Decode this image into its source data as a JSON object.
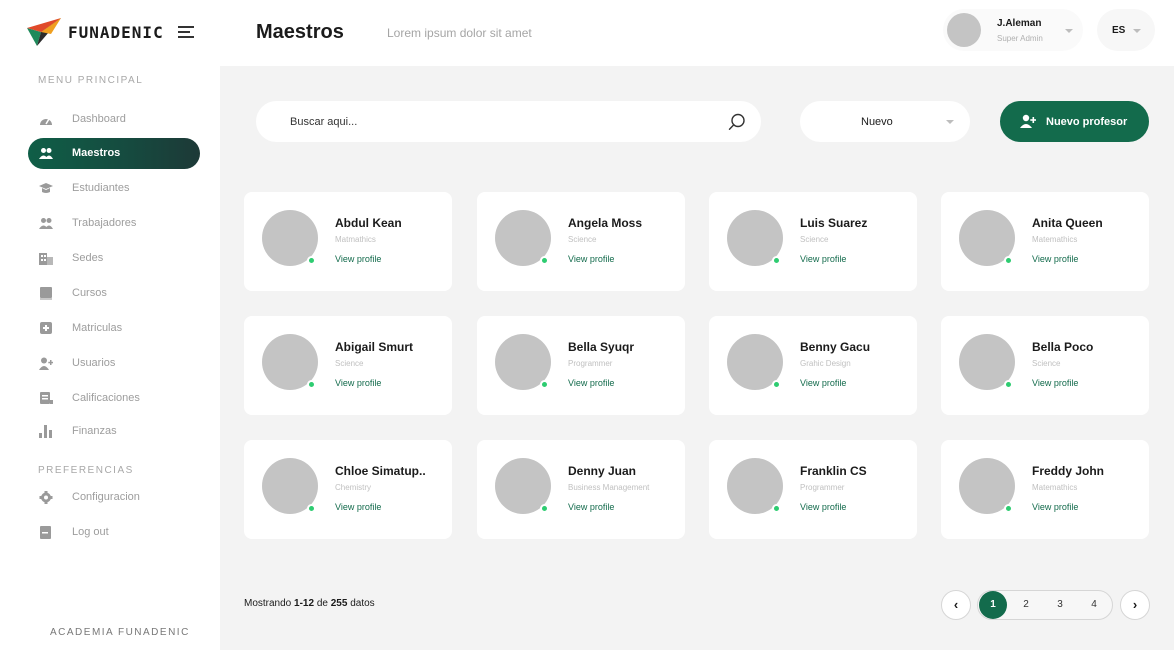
{
  "header": {
    "brand": "FUNADENIC",
    "title": "Maestros",
    "subtitle": "Lorem ipsum  dolor sit amet",
    "user": {
      "name": "J.Aleman",
      "role": "Super Admin"
    },
    "language": "ES"
  },
  "sidebar": {
    "main_section": "MENU PRINCIPAL",
    "items": [
      {
        "label": "Dashboard",
        "icon": "dashboard-icon"
      },
      {
        "label": "Maestros",
        "icon": "teachers-icon",
        "active": true
      },
      {
        "label": "Estudiantes",
        "icon": "graduation-cap-icon"
      },
      {
        "label": "Trabajadores",
        "icon": "workers-icon"
      },
      {
        "label": "Sedes",
        "icon": "building-icon"
      },
      {
        "label": "Cursos",
        "icon": "book-icon"
      },
      {
        "label": "Matriculas",
        "icon": "plus-square-icon"
      },
      {
        "label": "Usuarios",
        "icon": "add-user-icon"
      },
      {
        "label": "Calificaciones",
        "icon": "grades-icon"
      },
      {
        "label": "Finanzas",
        "icon": "bar-chart-icon"
      }
    ],
    "pref_section": "PREFERENCIAS",
    "pref_items": [
      {
        "label": "Configuracion",
        "icon": "gear-icon"
      },
      {
        "label": "Log out",
        "icon": "logout-icon"
      }
    ],
    "footer": "ACADEMIA FUNADENIC"
  },
  "toolbar": {
    "search_placeholder": "Buscar aqui...",
    "filter_value": "Nuevo",
    "new_button": "Nuevo profesor"
  },
  "teachers": [
    {
      "name": "Abdul Kean",
      "subject": "Matmathics",
      "link": "View profile"
    },
    {
      "name": "Angela Moss",
      "subject": "Science",
      "link": "View profile"
    },
    {
      "name": "Luis Suarez",
      "subject": "Science",
      "link": "View profile"
    },
    {
      "name": "Anita Queen",
      "subject": "Matemathics",
      "link": "View profile"
    },
    {
      "name": "Abigail Smurt",
      "subject": "Science",
      "link": "View profile"
    },
    {
      "name": "Bella Syuqr",
      "subject": "Programmer",
      "link": "View profile"
    },
    {
      "name": "Benny Gacu",
      "subject": "Grahic Design",
      "link": "View profile"
    },
    {
      "name": "Bella Poco",
      "subject": "Science",
      "link": "View profile"
    },
    {
      "name": "Chloe Simatup..",
      "subject": "Chemistry",
      "link": "View profile"
    },
    {
      "name": "Denny Juan",
      "subject": "Business Management",
      "link": "View profile"
    },
    {
      "name": "Franklin CS",
      "subject": "Programmer",
      "link": "View profile"
    },
    {
      "name": "Freddy John",
      "subject": "Matemathics",
      "link": "View profile"
    }
  ],
  "pagination": {
    "showing_prefix": "Mostrando",
    "range": "1-12",
    "of": "de",
    "total": "255",
    "suffix": "datos",
    "prev": "‹",
    "next": "›",
    "pages": [
      "1",
      "2",
      "3",
      "4"
    ],
    "current": "1"
  },
  "colors": {
    "accent": "#136b4c",
    "online": "#2ecc71",
    "avatar": "#c4c4c4"
  }
}
